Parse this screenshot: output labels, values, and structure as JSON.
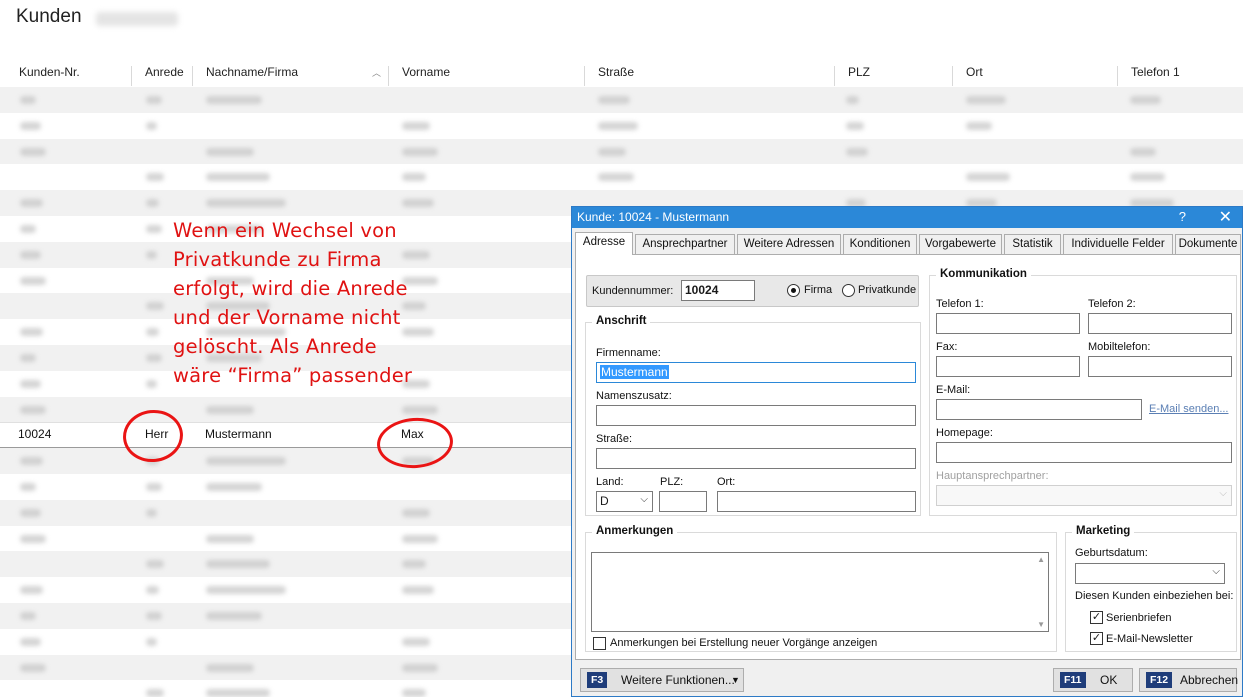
{
  "page": {
    "title": "Kunden"
  },
  "columns": [
    "Kunden-Nr.",
    "Anrede",
    "Nachname/Firma",
    "Vorname",
    "Straße",
    "PLZ",
    "Ort",
    "Telefon 1"
  ],
  "selected_row": {
    "kundennr": "10024",
    "anrede": "Herr",
    "nachname": "Mustermann",
    "vorname": "Max"
  },
  "annotation": {
    "lines": [
      "Wenn ein Wechsel von",
      "Privatkunde zu Firma",
      "erfolgt, wird die Anrede",
      "und der Vorname nicht",
      "gelöscht. Als Anrede",
      "wäre “Firma” passender"
    ],
    "color": "#e01212"
  },
  "dialog": {
    "title": "Kunde: 10024 - Mustermann",
    "help": "?",
    "close": "✕",
    "tabs": [
      "Adresse",
      "Ansprechpartner",
      "Weitere Adressen",
      "Konditionen",
      "Vorgabewerte",
      "Statistik",
      "Individuelle Felder",
      "Dokumente"
    ],
    "kundennummer_label": "Kundennummer:",
    "kundennummer": "10024",
    "radio_firma": "Firma",
    "radio_privat": "Privatkunde",
    "anschrift": {
      "title": "Anschrift",
      "firmenname_label": "Firmenname:",
      "firmenname": "Mustermann",
      "namenszusatz_label": "Namenszusatz:",
      "strasse_label": "Straße:",
      "land_label": "Land:",
      "land": "D",
      "plz_label": "PLZ:",
      "ort_label": "Ort:"
    },
    "kommunikation": {
      "title": "Kommunikation",
      "telefon1_label": "Telefon 1:",
      "telefon2_label": "Telefon 2:",
      "fax_label": "Fax:",
      "mobil_label": "Mobiltelefon:",
      "email_label": "E-Mail:",
      "email_link": "E-Mail senden...",
      "homepage_label": "Homepage:",
      "haupt_label": "Hauptansprechpartner:"
    },
    "anmerkungen": {
      "title": "Anmerkungen",
      "checkbox_label": "Anmerkungen bei Erstellung neuer Vorgänge anzeigen"
    },
    "marketing": {
      "title": "Marketing",
      "geburtsdatum_label": "Geburtsdatum:",
      "einbeziehen_label": "Diesen Kunden einbeziehen bei:",
      "serienbriefen": "Serienbriefen",
      "newsletter": "E-Mail-Newsletter"
    },
    "footer": {
      "f3_key": "F3",
      "f3_label": "Weitere Funktionen...",
      "f11_key": "F11",
      "ok_label": "OK",
      "f12_key": "F12",
      "cancel_label": "Abbrechen"
    }
  }
}
